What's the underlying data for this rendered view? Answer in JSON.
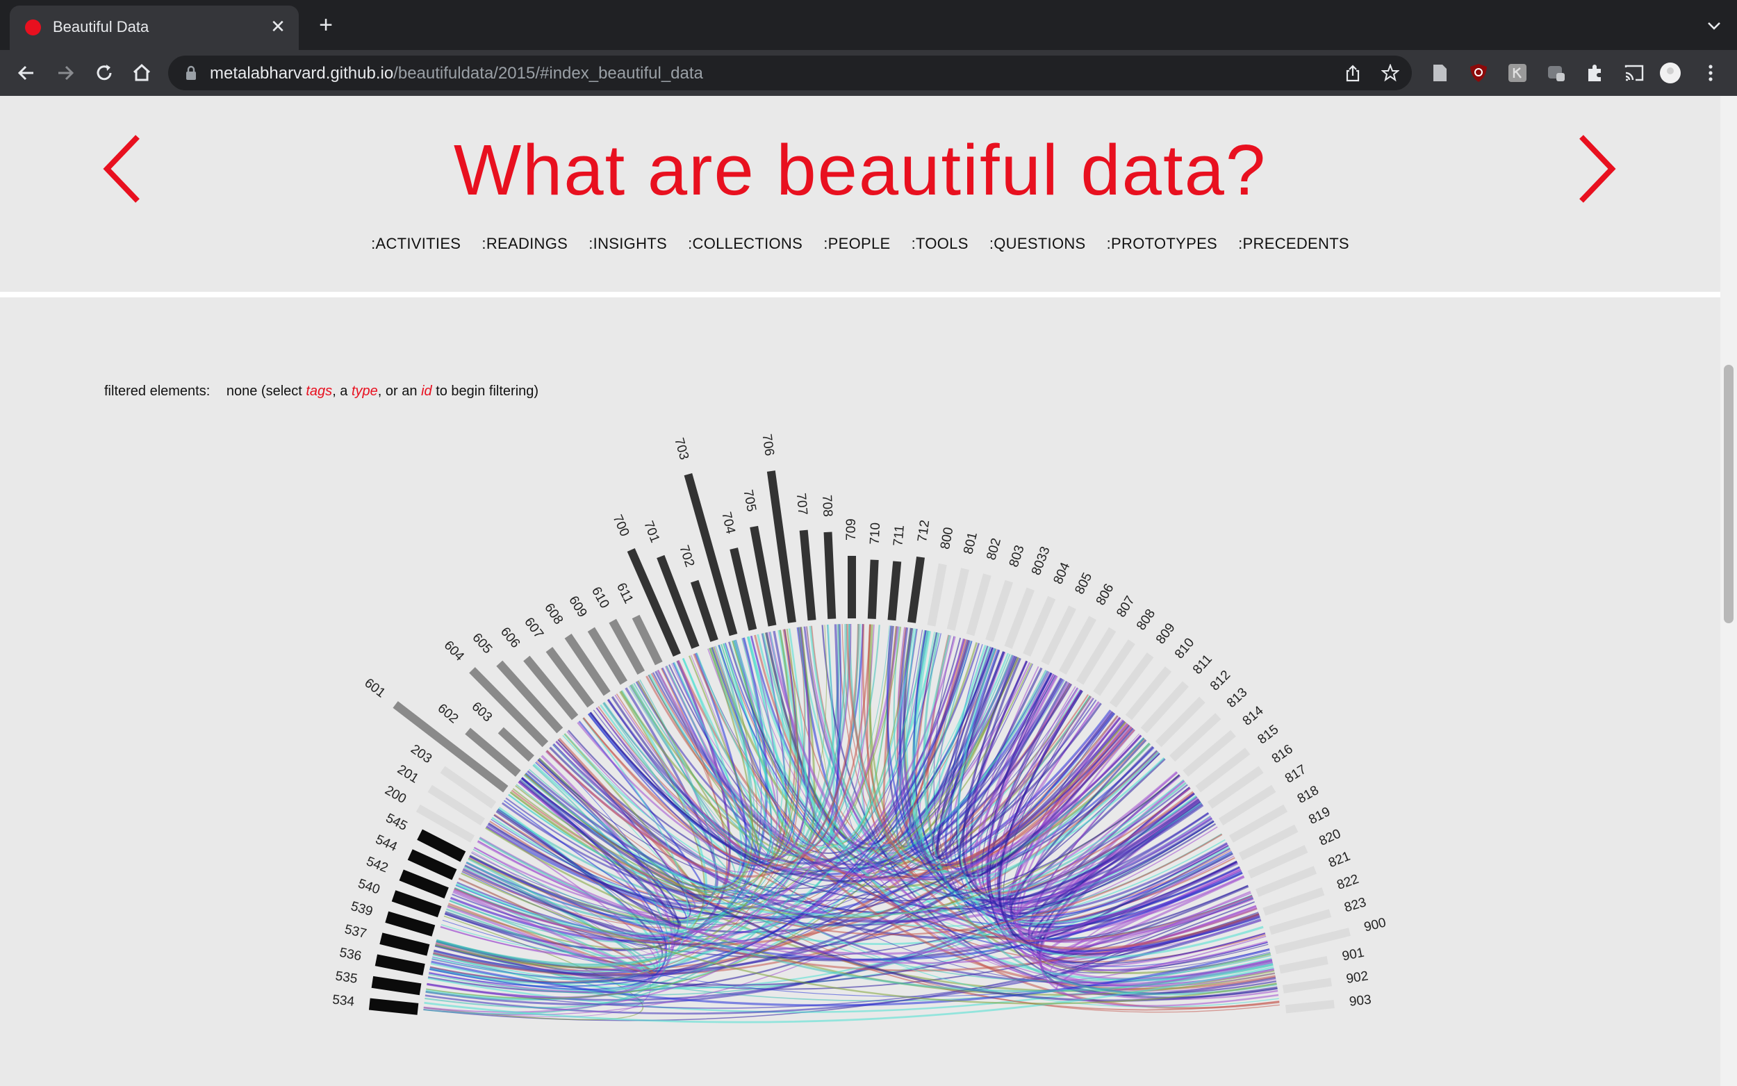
{
  "browser": {
    "tab_title": "Beautiful Data",
    "url_host": "metalabharvard.github.io",
    "url_path": "/beautifuldata/2015/#index_beautiful_data"
  },
  "header": {
    "title": "What are beautiful data?",
    "nav": [
      ":ACTIVITIES",
      ":READINGS",
      ":INSIGHTS",
      ":COLLECTIONS",
      ":PEOPLE",
      ":TOOLS",
      ":QUESTIONS",
      ":PROTOTYPES",
      ":PRECEDENTS"
    ]
  },
  "filter": {
    "label": "filtered elements:",
    "prefix": "none (select ",
    "tags": "tags",
    "sep1": ", a ",
    "type": "type",
    "sep2": ", or an ",
    "id": "id",
    "suffix": " to begin filtering)"
  },
  "chord_diagram": {
    "colors": {
      "accent": "#e8101f",
      "bar_black": "#0b0b0b",
      "bar_dark": "#333333",
      "bar_gray": "#8a8a8a",
      "bar_light": "#dcdcdc"
    },
    "groups": [
      {
        "ids": [
          "534",
          "535",
          "536",
          "537",
          "539",
          "540",
          "542",
          "544",
          "545"
        ],
        "shade": "black"
      },
      {
        "ids": [
          "200",
          "201",
          "203"
        ],
        "shade": "light"
      },
      {
        "ids": [
          "601",
          "602",
          "603",
          "604",
          "605",
          "606",
          "607",
          "608",
          "609",
          "610",
          "611"
        ],
        "shade": "gray"
      },
      {
        "ids": [
          "700",
          "701",
          "702",
          "703",
          "704",
          "705",
          "706",
          "707",
          "708",
          "709",
          "710",
          "711",
          "712"
        ],
        "shade": "dark"
      },
      {
        "ids": [
          "800",
          "801",
          "802",
          "803",
          "8033",
          "804",
          "805",
          "806",
          "807",
          "808",
          "809",
          "810",
          "811",
          "812",
          "813",
          "814",
          "815",
          "816",
          "817",
          "818",
          "819",
          "820",
          "821",
          "822",
          "823"
        ],
        "shade": "light"
      },
      {
        "ids": [
          "900",
          "901",
          "902",
          "903"
        ],
        "shade": "light"
      }
    ],
    "chord_colors": [
      "#3fc2b8",
      "#2330d8",
      "#2a1ea0",
      "#a14fd0",
      "#7fa43a",
      "#c4574f",
      "#4be0d2",
      "#3a2db8"
    ]
  }
}
